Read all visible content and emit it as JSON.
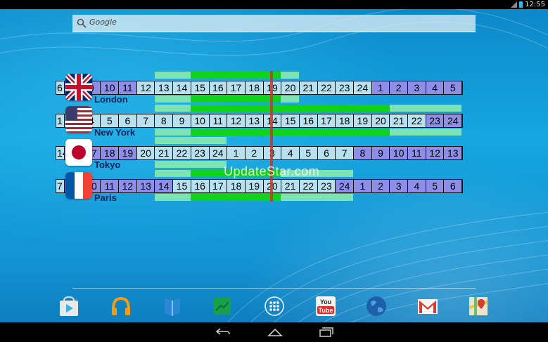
{
  "status_bar": {
    "time": "12:55"
  },
  "search": {
    "placeholder": "Google"
  },
  "widget": {
    "watermark": "UpdateStar.com",
    "cities": [
      {
        "name": "London",
        "hours": [
          "6",
          "8",
          "9",
          "10",
          "11",
          "12",
          "13",
          "14",
          "15",
          "16",
          "17",
          "18",
          "19",
          "20",
          "21",
          "22",
          "23",
          "24",
          "1",
          "2",
          "3",
          "4",
          "5"
        ],
        "night_indices": [
          1,
          2,
          3,
          4,
          18,
          19,
          20,
          21,
          22
        ],
        "work_light": [
          6,
          13
        ],
        "work_green": [
          8,
          12
        ]
      },
      {
        "name": "New York",
        "hours": [
          "1",
          "3",
          "4",
          "5",
          "6",
          "7",
          "8",
          "9",
          "10",
          "11",
          "12",
          "13",
          "14",
          "15",
          "16",
          "17",
          "18",
          "19",
          "20",
          "21",
          "22",
          "23",
          "24"
        ],
        "night_indices": [
          21,
          22
        ],
        "work_light": [
          6,
          22
        ],
        "work_green": [
          8,
          18
        ]
      },
      {
        "name": "Tokyo",
        "hours": [
          "14",
          "16",
          "17",
          "18",
          "19",
          "20",
          "21",
          "22",
          "23",
          "24",
          "1",
          "2",
          "3",
          "4",
          "5",
          "6",
          "7",
          "8",
          "9",
          "10",
          "11",
          "12",
          "13"
        ],
        "night_indices": [
          1,
          2,
          3,
          4,
          17,
          18,
          19,
          20,
          21,
          22
        ],
        "work_light": [
          6,
          9
        ],
        "work_green": []
      },
      {
        "name": "Paris",
        "hours": [
          "7",
          "9",
          "10",
          "11",
          "12",
          "13",
          "14",
          "15",
          "16",
          "17",
          "18",
          "19",
          "20",
          "21",
          "22",
          "23",
          "24",
          "1",
          "2",
          "3",
          "4",
          "5",
          "6"
        ],
        "night_indices": [
          1,
          2,
          3,
          4,
          5,
          6,
          16,
          17,
          18,
          19,
          20,
          21,
          22
        ],
        "work_light": [
          6,
          16
        ],
        "work_green": [
          8,
          12
        ]
      }
    ]
  },
  "dock": {
    "icons": [
      "play-store-icon",
      "play-music-icon",
      "play-books-icon",
      "sheets-icon",
      "app-drawer-icon",
      "youtube-icon",
      "earth-icon",
      "gmail-icon",
      "maps-icon"
    ],
    "youtube_label": "You Tube"
  },
  "colors": {
    "day_cell": "#b7e1ee",
    "night_cell": "#8e8ee8",
    "work_light": "#7de3b2",
    "work_core": "#11d21a",
    "now_line": "#c0392b"
  }
}
